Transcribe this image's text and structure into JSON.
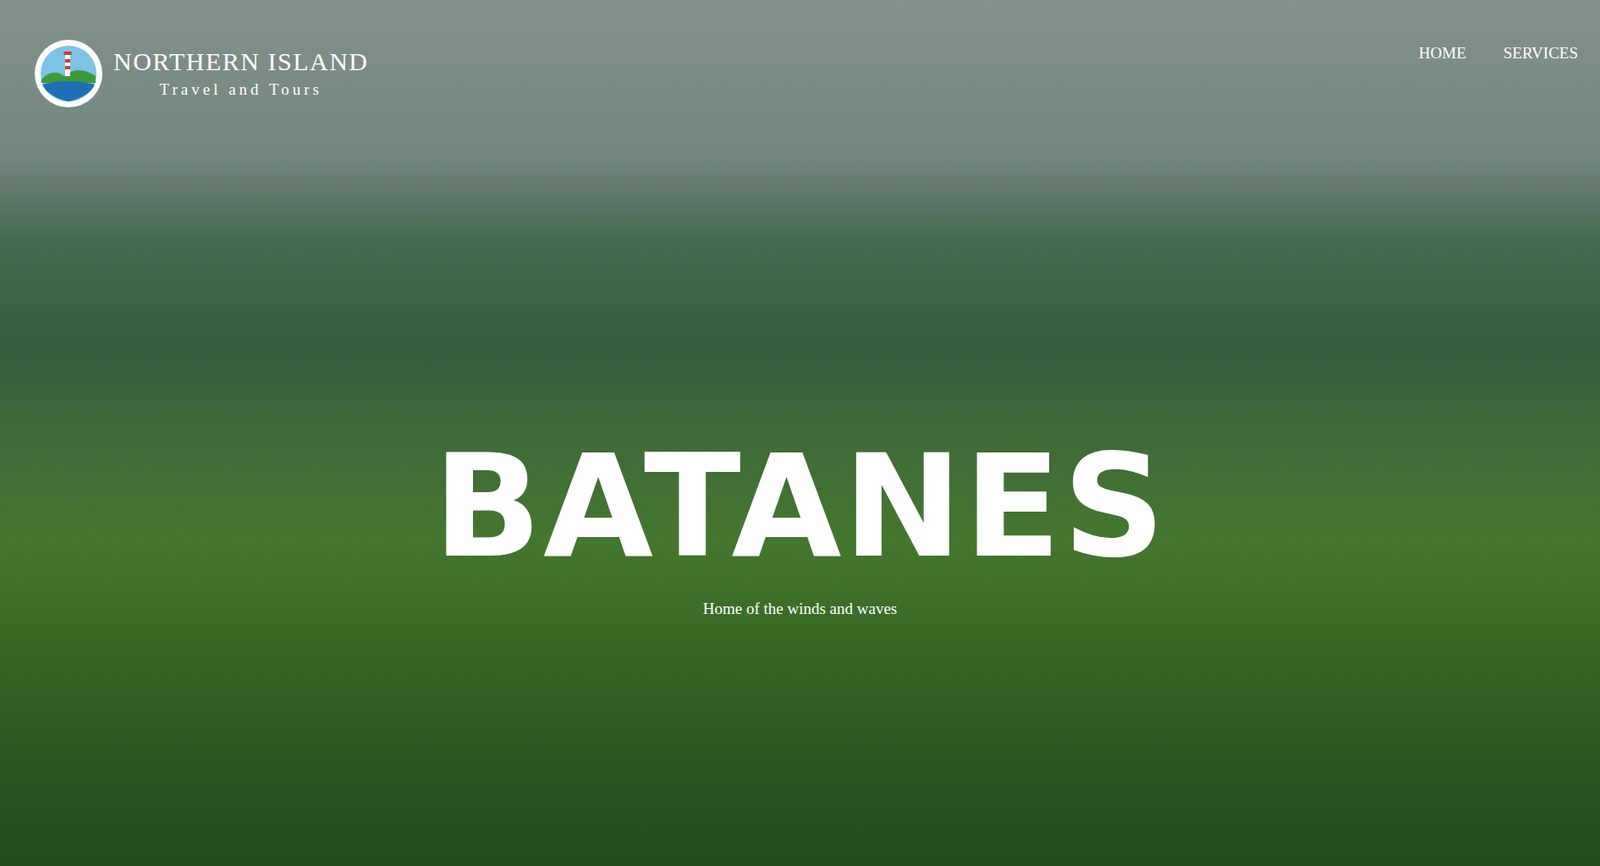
{
  "brand": {
    "name": "NORTHERN ISLAND",
    "tagline": "Travel and Tours"
  },
  "nav": [
    {
      "label": "HOME"
    },
    {
      "label": "SERVICES"
    }
  ],
  "hero": {
    "title": "BATANES",
    "subtitle": "Home of the winds and waves"
  }
}
